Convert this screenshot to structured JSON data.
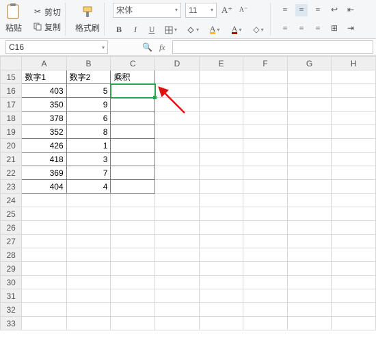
{
  "toolbar": {
    "paste": "粘贴",
    "cut": "剪切",
    "copy": "复制",
    "format_painter": "格式刷",
    "font_name": "宋体",
    "font_size": "11"
  },
  "namebox": {
    "active_cell": "C16"
  },
  "headers": {
    "cols": [
      "A",
      "B",
      "C",
      "D",
      "E",
      "F",
      "G",
      "H"
    ]
  },
  "rows": {
    "start": 15,
    "end": 33
  },
  "data": {
    "A15": "数字1",
    "B15": "数字2",
    "C15": "乘积",
    "A16": "403",
    "B16": "5",
    "A17": "350",
    "B17": "9",
    "A18": "378",
    "B18": "6",
    "A19": "352",
    "B19": "8",
    "A20": "426",
    "B20": "1",
    "A21": "418",
    "B21": "3",
    "A22": "369",
    "B22": "7",
    "A23": "404",
    "B23": "4"
  },
  "selected": "C16"
}
